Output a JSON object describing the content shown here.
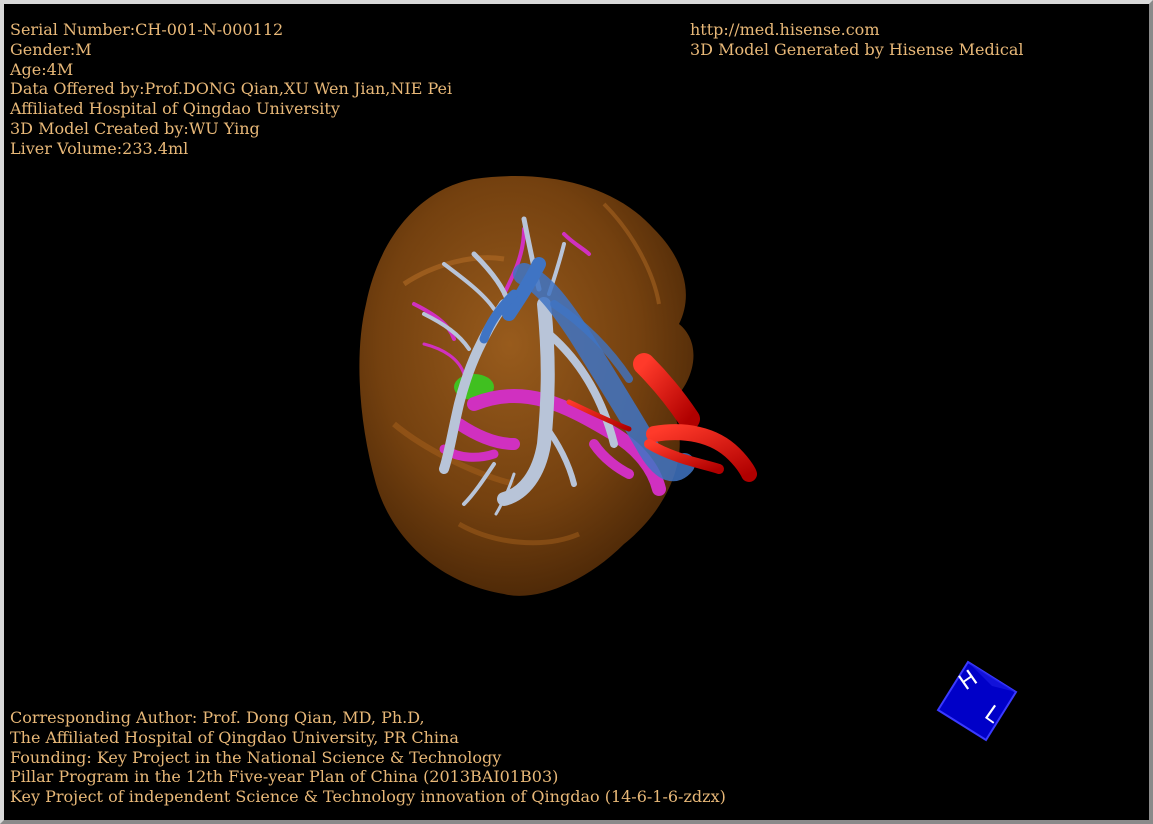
{
  "header_left": {
    "lines": [
      "Serial Number:CH-001-N-000112",
      "Gender:M",
      "Age:4M",
      "Data Offered by:Prof.DONG Qian,XU Wen Jian,NIE Pei",
      "Affiliated Hospital of Qingdao University",
      "3D Model Created by:WU Ying",
      "Liver Volume:233.4ml"
    ]
  },
  "header_right": {
    "lines": [
      "http://med.hisense.com",
      "3D Model Generated by Hisense Medical"
    ]
  },
  "footer_left": {
    "lines": [
      "Corresponding Author: Prof. Dong Qian, MD, Ph.D,",
      "The Affiliated Hospital of Qingdao University, PR China",
      "Founding: Key Project in the National Science & Technology",
      "Pillar Program in the 12th Five-year Plan of China (2013BAI01B03)",
      "Key Project of independent Science & Technology innovation of Qingdao (14-6-1-6-zdzx)"
    ]
  },
  "orientation_cube": {
    "face_letters": [
      "H",
      "L"
    ]
  },
  "colors": {
    "background": "#000000",
    "text": "#e8b878",
    "liver": "#8a4e16",
    "hepatic_vein": "#b8c4d8",
    "portal_vein": "#3f74c4",
    "artery": "#e01010",
    "bile_duct": "#d030c0",
    "gallbladder": "#40c020",
    "cube": "#0000c8"
  }
}
